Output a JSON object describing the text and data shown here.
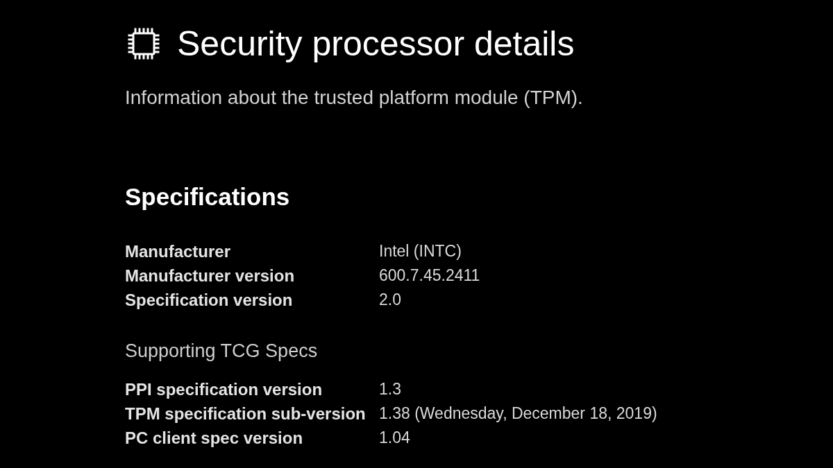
{
  "header": {
    "title": "Security processor details",
    "description": "Information about the trusted platform module (TPM)."
  },
  "sections": [
    {
      "kind": "primary",
      "heading": "Specifications",
      "rows": [
        {
          "label": "Manufacturer",
          "value": "Intel (INTC)"
        },
        {
          "label": "Manufacturer version",
          "value": "600.7.45.2411"
        },
        {
          "label": "Specification version",
          "value": "2.0"
        }
      ]
    },
    {
      "kind": "secondary",
      "heading": "Supporting TCG Specs",
      "rows": [
        {
          "label": "PPI specification version",
          "value": "1.3"
        },
        {
          "label": "TPM specification sub-version",
          "value": "1.38 (Wednesday, December 18, 2019)"
        },
        {
          "label": "PC client spec version",
          "value": "1.04"
        }
      ]
    }
  ]
}
